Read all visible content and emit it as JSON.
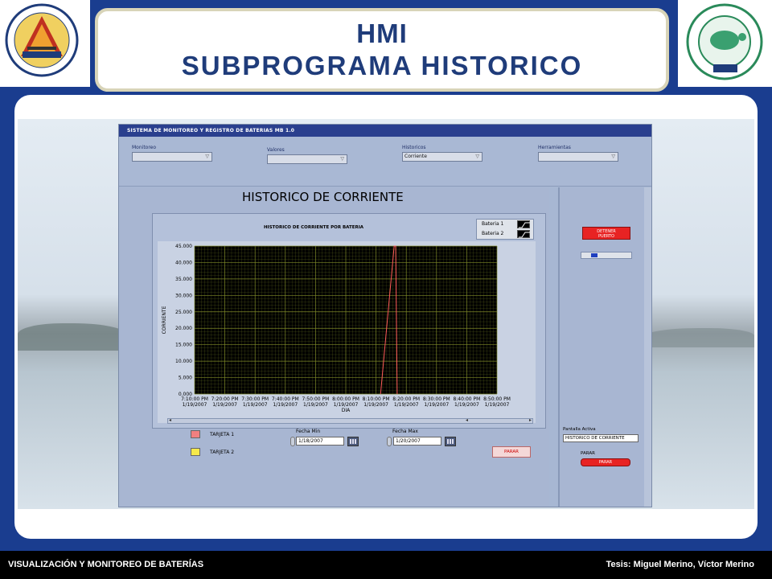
{
  "slide": {
    "title_line1": "HMI",
    "title_line2": "SUBPROGRAMA HISTORICO"
  },
  "logos": {
    "left_alt": "ARMADA DEL ECUADOR",
    "left_sub": "Dirección de Investigación y Desarrollo Naval",
    "right_alt": "ESCUELA SUPERIOR POLITECNICA DEL LITORAL",
    "right_sub": "ESPOL"
  },
  "app": {
    "window_title": "SISTEMA DE MONITOREO Y REGISTRO DE BATERIAS   MB 1.0",
    "menus": [
      {
        "label": "Monitoreo",
        "value": ""
      },
      {
        "label": "Valores",
        "value": ""
      },
      {
        "label": "Historicos",
        "value": "Corriente"
      },
      {
        "label": "Herramientas",
        "value": ""
      }
    ],
    "panel_title": "HISTORICO DE CORRIENTE",
    "legend": [
      "Bateria 1",
      "Bateria 2"
    ],
    "leds": [
      {
        "label": "TARJETA 1",
        "color": "#f08080"
      },
      {
        "label": "TARJETA 2",
        "color": "#f6e94a"
      }
    ],
    "fecha_min_label": "Fecha Min",
    "fecha_min_value": "1/18/2007",
    "fecha_max_label": "Fecha Max",
    "fecha_max_value": "1/20/2007",
    "parar_small": "PARAR",
    "detener_line1": "DETENER",
    "detener_line2": "PUERTO",
    "pantalla_label": "Pantalla Activa",
    "pantalla_value": "HISTORICO DE CORRIENTE",
    "parar_label": "PARAR",
    "parar_button": "PARAR"
  },
  "chart_data": {
    "type": "line",
    "title": "HISTORICO DE CORRIENTE POR BATERIA",
    "xlabel": "DIA",
    "ylabel": "CORRIENTE",
    "ylim": [
      0,
      45
    ],
    "yticks": [
      "45.000",
      "40.000",
      "35.000",
      "30.000",
      "25.000",
      "20.000",
      "15.000",
      "10.000",
      "5.000",
      "0.000"
    ],
    "xticks": [
      {
        "time": "7:10:00 PM",
        "date": "1/19/2007"
      },
      {
        "time": "7:20:00 PM",
        "date": "1/19/2007"
      },
      {
        "time": "7:30:00 PM",
        "date": "1/19/2007"
      },
      {
        "time": "7:40:00 PM",
        "date": "1/19/2007"
      },
      {
        "time": "7:50:00 PM",
        "date": "1/19/2007"
      },
      {
        "time": "8:00:00 PM",
        "date": "1/19/2007"
      },
      {
        "time": "8:10:00 PM",
        "date": "1/19/2007"
      },
      {
        "time": "8:20:00 PM",
        "date": "1/19/2007"
      },
      {
        "time": "8:30:00 PM",
        "date": "1/19/2007"
      },
      {
        "time": "8:40:00 PM",
        "date": "1/19/2007"
      },
      {
        "time": "8:50:00 PM",
        "date": "1/19/2007"
      }
    ],
    "grid": true,
    "legend_position": "top-right",
    "plot_background": "#000000",
    "grid_color": "#7f8a28",
    "series": [
      {
        "name": "Bateria 1",
        "color": "#ff5a5a",
        "points": [
          [
            "8:11:30 PM",
            0
          ],
          [
            "8:16:00 PM",
            45
          ],
          [
            "8:16:30 PM",
            45
          ],
          [
            "8:17:00 PM",
            0
          ]
        ]
      },
      {
        "name": "Bateria 2",
        "color": "#f6e94a",
        "points": []
      }
    ]
  },
  "footer": {
    "left": "VISUALIZACIÓN Y MONITOREO DE BATERÍAS",
    "right": "Tesis: Miguel Merino, Víctor Merino"
  }
}
